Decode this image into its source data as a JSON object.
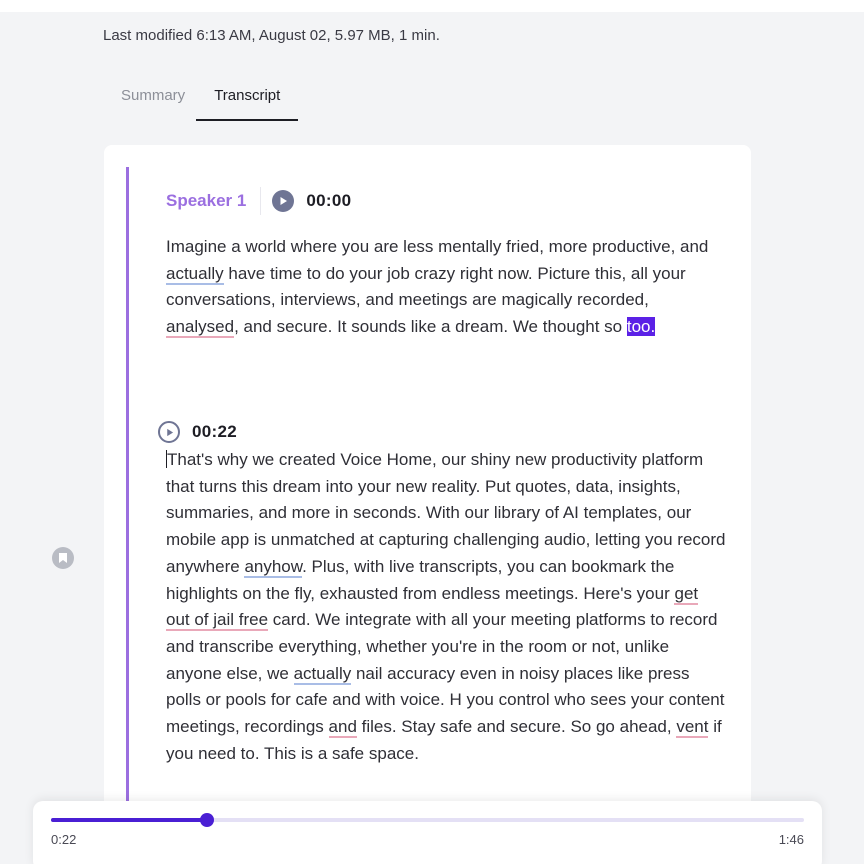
{
  "file": {
    "meta": "Last modified 6:13 AM, August 02, 5.97 MB, 1 min."
  },
  "tabs": [
    {
      "label": "Summary",
      "active": false
    },
    {
      "label": "Transcript",
      "active": true
    }
  ],
  "transcript": {
    "speaker": "Speaker 1",
    "accent_color": "#9b6fe0",
    "highlight_color": "#5b21e6",
    "segments": [
      {
        "time": "00:00",
        "parts": [
          "Imagine a world where you are less mentally fried, more productive, and ",
          "actually",
          " have time to do your job crazy right now. Picture this, all your conversations, interviews, and meetings are magically recorded, ",
          "analysed",
          ", and secure. It sounds like a dream. We thought so ",
          "too."
        ]
      },
      {
        "time": "00:22",
        "parts": [
          "That's why we created Voice Home, our shiny new productivity platform that turns this dream into your new reality. Put quotes, data, insights, summaries, and more in seconds. With our library of AI templates, our mobile app is unmatched at capturing challenging audio, letting you record anywhere ",
          "anyhow",
          ". Plus, with live transcripts, you can bookmark the highlights on the fly, exhausted from endless meetings. Here's your ",
          "get out of jail free",
          " card. We integrate with all your meeting platforms to record and transcribe everything, whether you're in the room or not, unlike anyone else, we ",
          "actually",
          " nail accuracy even in noisy places like press polls or pools for cafe and with voice. H you control who sees your content meetings, recordings ",
          "and",
          " files. Stay safe and secure. So go ahead, ",
          "vent",
          " if you need to. This is a safe space."
        ]
      }
    ]
  },
  "icons": {
    "play_filled": "play-circle-filled-icon",
    "play_outline": "play-circle-outline-icon",
    "bookmark": "bookmark-icon"
  },
  "player": {
    "current": "0:22",
    "duration": "1:46",
    "progress_fraction": 0.2075,
    "color": "#4a1fd4"
  }
}
